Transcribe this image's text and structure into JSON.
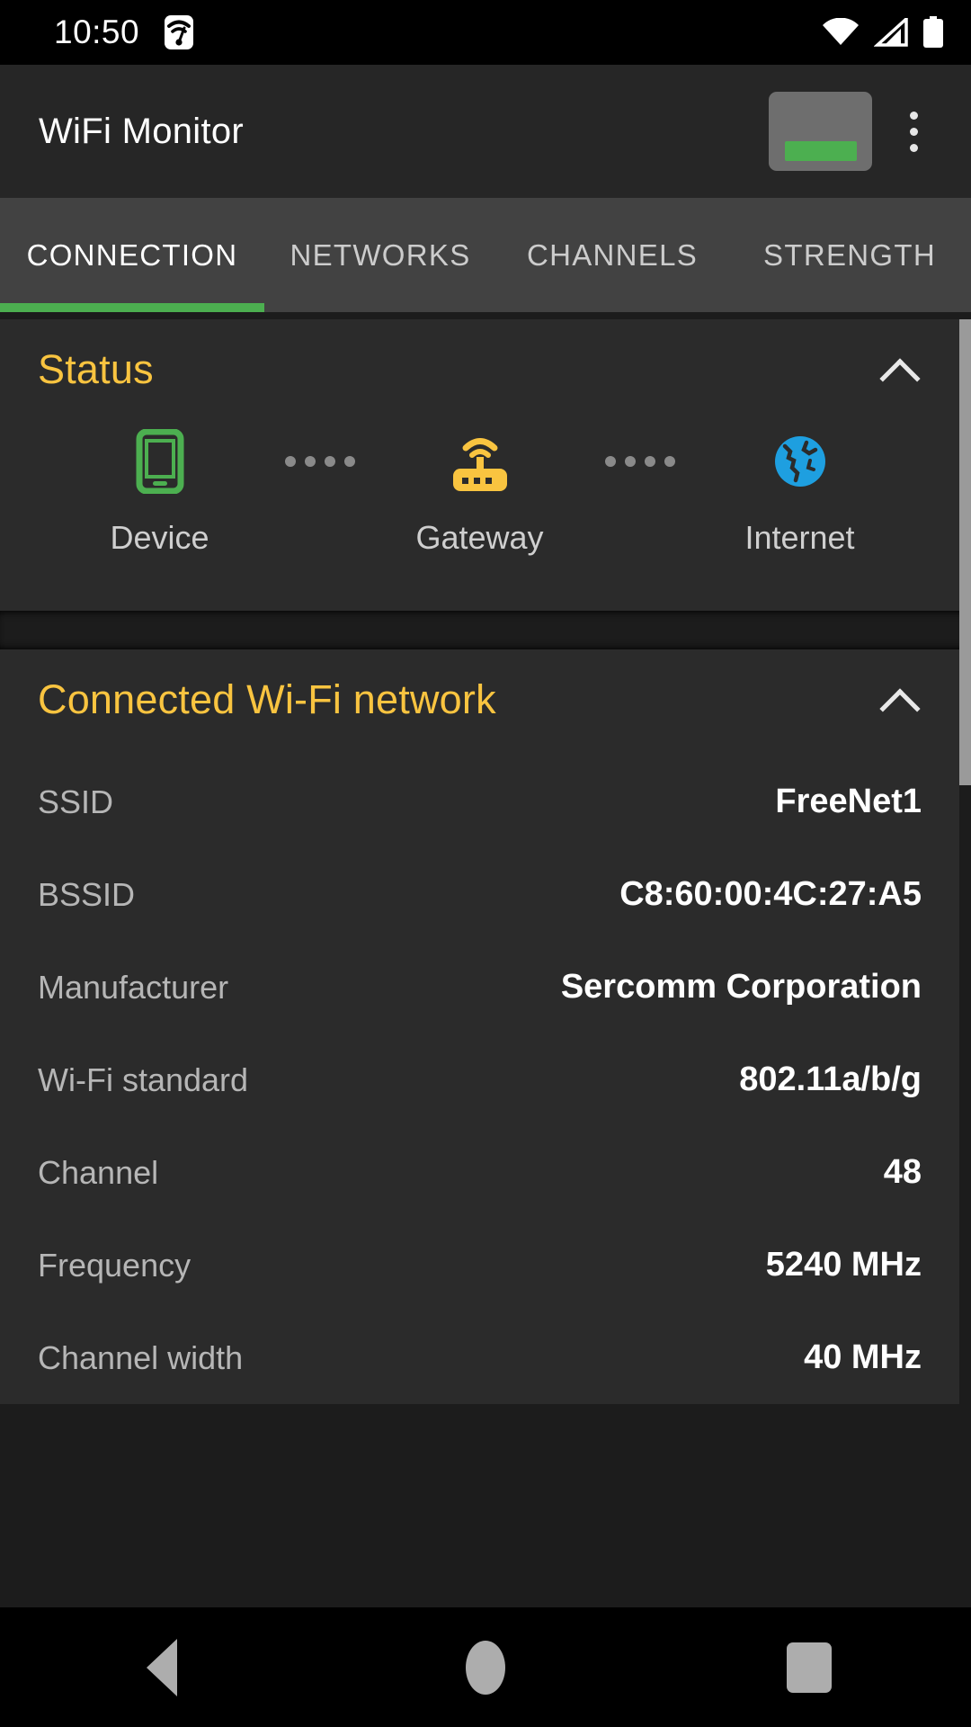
{
  "statusbar": {
    "time": "10:50",
    "left_icons": [
      "wifi-speedtest-icon"
    ],
    "right_icons": [
      "wifi-icon",
      "cellular-signal-icon",
      "battery-icon"
    ]
  },
  "appbar": {
    "title": "WiFi Monitor",
    "signal_widget": {
      "name": "signal-strength-widget",
      "accent": "#4caf50"
    },
    "overflow_label": "more-options"
  },
  "tabs": {
    "active_index": 0,
    "indicator_color": "#4caf50",
    "items": [
      {
        "label": "CONNECTION"
      },
      {
        "label": "NETWORKS"
      },
      {
        "label": "CHANNELS"
      },
      {
        "label": "STRENGTH"
      }
    ]
  },
  "status_card": {
    "title": "Status",
    "title_color": "#f9c440",
    "collapse_icon": "chevron-up-icon",
    "nodes": [
      {
        "label": "Device",
        "icon": "smartphone-icon",
        "color": "#4caf50"
      },
      {
        "label": "Gateway",
        "icon": "router-icon",
        "color": "#f9c440"
      },
      {
        "label": "Internet",
        "icon": "globe-icon",
        "color": "#1e9fe0"
      }
    ],
    "connector": "dotted-line"
  },
  "network_card": {
    "title": "Connected Wi-Fi network",
    "title_color": "#f9c440",
    "collapse_icon": "chevron-up-icon",
    "rows": [
      {
        "label": "SSID",
        "value": "FreeNet1"
      },
      {
        "label": "BSSID",
        "value": "C8:60:00:4C:27:A5"
      },
      {
        "label": "Manufacturer",
        "value": "Sercomm Corporation"
      },
      {
        "label": "Wi-Fi standard",
        "value": "802.11a/b/g"
      },
      {
        "label": "Channel",
        "value": "48"
      },
      {
        "label": "Frequency",
        "value": "5240 MHz"
      },
      {
        "label": "Channel width",
        "value": "40 MHz"
      }
    ]
  },
  "navbar": {
    "back": "back-button",
    "home": "home-button",
    "recents": "recents-button"
  }
}
